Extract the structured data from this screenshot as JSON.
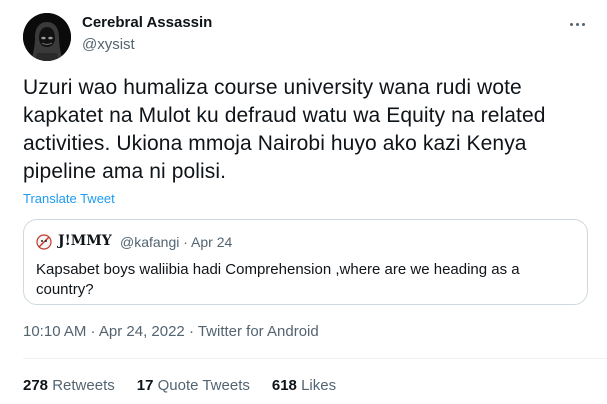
{
  "author": {
    "name": "Cerebral Assassin",
    "handle": "@xysist"
  },
  "tweet": {
    "text": "Uzuri wao humaliza course university wana rudi wote kapkatet na Mulot ku defraud watu wa Equity na related activities. Ukiona mmoja Nairobi huyo ako kazi Kenya pipeline ama ni polisi.",
    "translate_label": "Translate Tweet"
  },
  "quote": {
    "name": "J!MMY",
    "handle_date": "@kafangi · Apr 24",
    "text": "Kapsabet boys waliibia hadi Comprehension ,where are we heading as a country?"
  },
  "meta": {
    "timestamp": "10:10 AM · Apr 24, 2022 · Twitter for Android"
  },
  "stats": {
    "retweets": {
      "count": "278",
      "label": "Retweets"
    },
    "quotes": {
      "count": "17",
      "label": "Quote Tweets"
    },
    "likes": {
      "count": "618",
      "label": "Likes"
    }
  },
  "colors": {
    "link": "#1d9bf0",
    "secondary_text": "#536471",
    "primary_text": "#0f1419",
    "border": "#cfd9de"
  },
  "icons": {
    "avatar": "hooded-figure-avatar",
    "quote_avatar": "emoji-avatar",
    "more": "more-dots-icon"
  }
}
